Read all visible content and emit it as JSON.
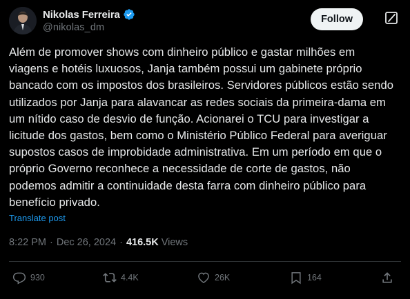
{
  "author": {
    "display_name": "Nikolas Ferreira",
    "handle": "@nikolas_dm",
    "verified": true,
    "verified_color": "#1d9bf0"
  },
  "header": {
    "follow_label": "Follow",
    "grok_icon": "grok-icon"
  },
  "post": {
    "lines": [
      "Além de promover shows com dinheiro público e gastar milhões em",
      "viagens e hotéis luxuosos, Janja também possui um gabinete próprio",
      "bancado com os impostos dos brasileiros. Servidores públicos estão sendo",
      "utilizados por Janja para alavancar as redes sociais da primeira-dama em",
      "um nítido caso de desvio de função. Acionarei o TCU para investigar a",
      "licitude dos gastos, bem como o Ministério Público Federal para averiguar",
      "supostos casos de improbidade administrativa. Em um período em que o",
      "próprio Governo reconhece a necessidade de corte de gastos, não",
      "podemos admitir a continuidade desta farra com dinheiro público para",
      "benefício privado."
    ],
    "translate_label": "Translate post",
    "time": "8:22 PM",
    "separator": "·",
    "date": "Dec 26, 2024",
    "views_count": "416.5K",
    "views_label": "Views"
  },
  "actions": {
    "replies": "930",
    "reposts": "4.4K",
    "likes": "26K",
    "bookmarks": "164"
  },
  "colors": {
    "background": "#000000",
    "text": "#e7e9ea",
    "muted": "#71767b",
    "link": "#1d9bf0",
    "divider": "#2f3336"
  }
}
